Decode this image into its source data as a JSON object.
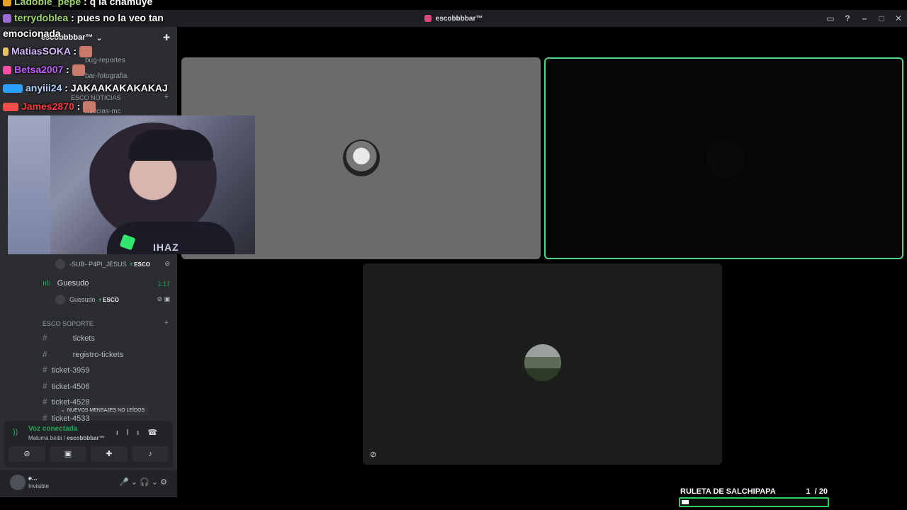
{
  "titlebar": {
    "server_name": "escobbbbar™"
  },
  "sidebar": {
    "server_header": "escobbbbar™",
    "channels_top": [
      {
        "label": "bug-reportes"
      },
      {
        "label": "bar-fotografia"
      }
    ],
    "category_noticias": "ESCO NOTICIAS",
    "channel_noticias": "noticias-mc",
    "voice_users": [
      {
        "name": "-SUB- P4PI_JESUS",
        "badge": "ESCO"
      }
    ],
    "voice_channel": {
      "name": "Guesudo",
      "timer": "1:17"
    },
    "voice_channel_user": {
      "name": "Guesudo",
      "badge": "ESCO"
    },
    "category_soporte": "ESCO SOPORTE",
    "soporte_channels": [
      {
        "label": "tickets"
      },
      {
        "label": "registro-tickets"
      },
      {
        "label": "ticket-3959"
      },
      {
        "label": "ticket-4506"
      },
      {
        "label": "ticket-4528"
      },
      {
        "label": "ticket-4533"
      }
    ],
    "new_messages": "NUEVOS MENSAJES NO LEÍDOS"
  },
  "voice_panel": {
    "status": "Voz conectada",
    "location_channel": "Maluma beibi",
    "location_server": "escobbbbar™"
  },
  "user_panel": {
    "name": "e...",
    "status": "Invisible"
  },
  "webcam": {
    "shirt_text": "IHAZ"
  },
  "chat": [
    {
      "user": "terrydoblea",
      "message": ": pues no la veo tan"
    },
    {
      "user": "",
      "message": "emocionada"
    },
    {
      "user": "MatiasSOKA",
      "message": " :"
    },
    {
      "user": "Betsa2007",
      "message": " :"
    },
    {
      "user": "anyiii24",
      "message": " : JAKAAKAKAKAKAJ"
    },
    {
      "user": "James2870",
      "message": " :"
    }
  ],
  "chat_top_partial": {
    "user": "Ladoble_pepe",
    "message": " : q la chamuye"
  },
  "ruleta": {
    "title": "RULETA DE SALCHIPAPA",
    "current": "1",
    "total": "/ 20",
    "progress": 0.05
  },
  "icons": {
    "minimize": "minimize-icon",
    "maximize": "maximize-icon",
    "close": "close-icon",
    "inbox": "inbox-icon",
    "help": "help-icon"
  }
}
